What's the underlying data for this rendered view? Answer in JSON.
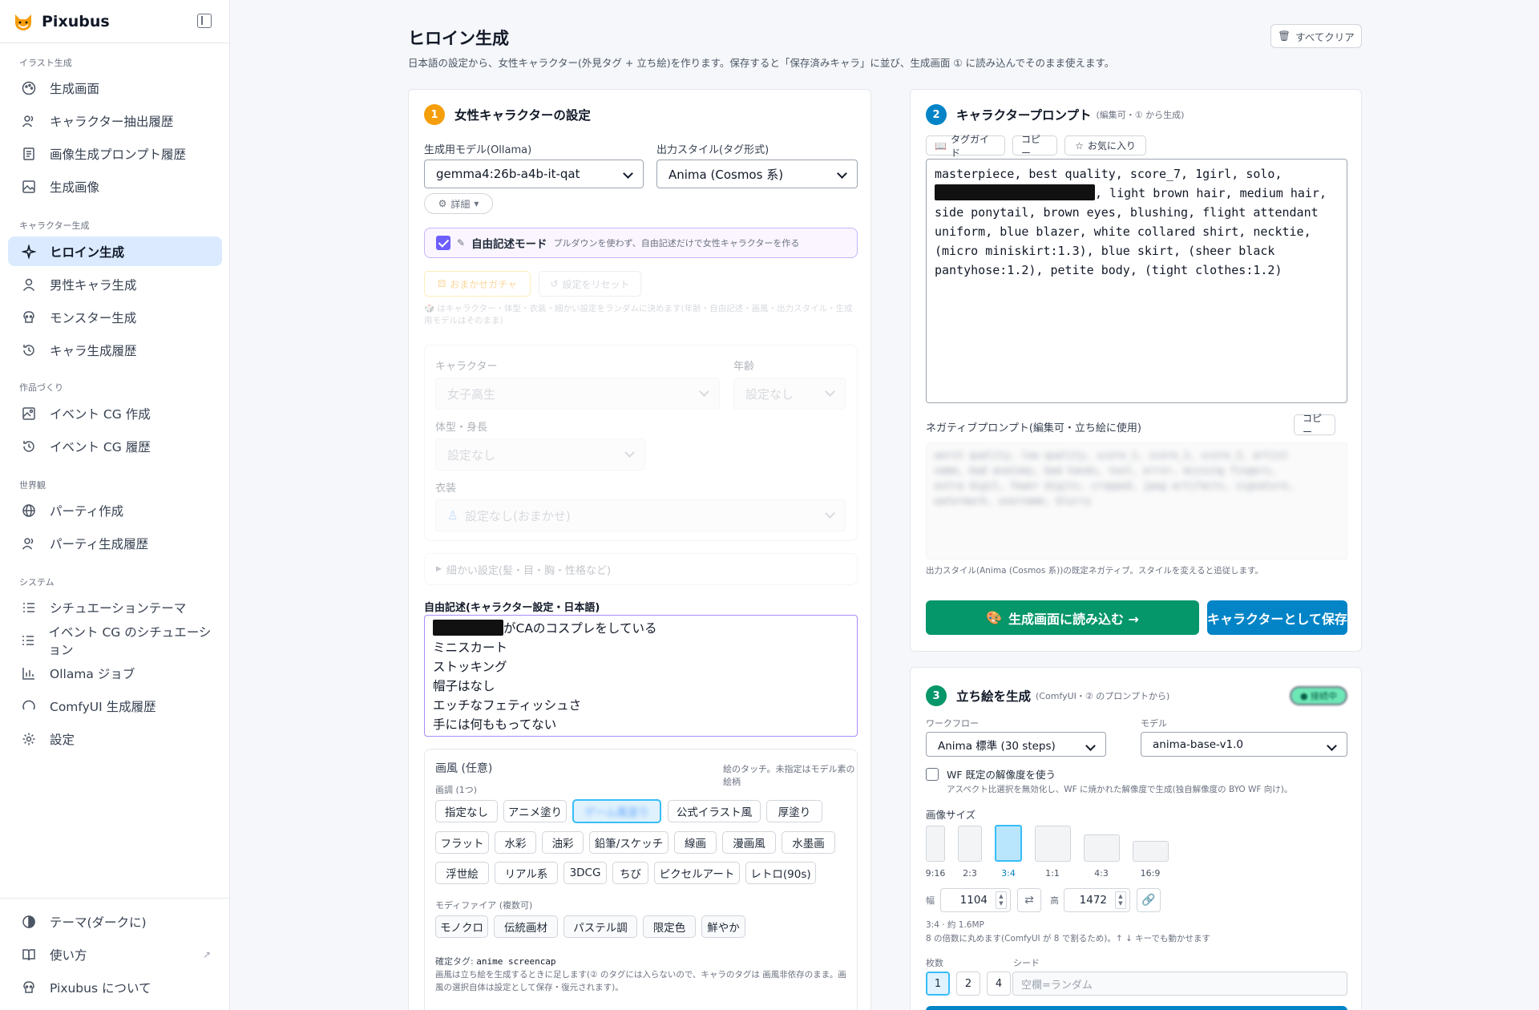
{
  "app": {
    "name": "Pixubus"
  },
  "sidebar": {
    "sections": [
      {
        "title": "イラスト生成",
        "items": [
          {
            "label": "生成画面",
            "icon": "palette-icon"
          },
          {
            "label": "キャラクター抽出履歴",
            "icon": "users-icon"
          },
          {
            "label": "画像生成プロンプト履歴",
            "icon": "scroll-icon"
          },
          {
            "label": "生成画像",
            "icon": "images-icon"
          }
        ]
      },
      {
        "title": "キャラクター生成",
        "items": [
          {
            "label": "ヒロイン生成",
            "icon": "sparkles-icon"
          },
          {
            "label": "男性キャラ生成",
            "icon": "user-icon"
          },
          {
            "label": "モンスター生成",
            "icon": "skull-icon"
          },
          {
            "label": "キャラ生成履歴",
            "icon": "history-icon"
          }
        ]
      },
      {
        "title": "作品づくり",
        "items": [
          {
            "label": "イベント CG 作成",
            "icon": "image-plus-icon"
          },
          {
            "label": "イベント CG 履歴",
            "icon": "history-icon"
          }
        ]
      },
      {
        "title": "世界観",
        "items": [
          {
            "label": "パーティ作成",
            "icon": "globe-icon"
          },
          {
            "label": "パーティ生成履歴",
            "icon": "users-icon"
          }
        ]
      },
      {
        "title": "システム",
        "items": [
          {
            "label": "シチュエーションテーマ",
            "icon": "list-icon"
          },
          {
            "label": "イベント CG のシチュエーション",
            "icon": "list-icon"
          },
          {
            "label": "Ollama ジョブ",
            "icon": "bar-chart-icon"
          },
          {
            "label": "ComfyUI 生成履歴",
            "icon": "loader-icon"
          },
          {
            "label": "設定",
            "icon": "gear-icon"
          }
        ]
      }
    ],
    "active": "ヒロイン生成",
    "bottom": [
      {
        "label": "テーマ(ダークに)",
        "icon": "theme-icon"
      },
      {
        "label": "使い方",
        "icon": "book-icon"
      },
      {
        "label": "Pixubus について",
        "icon": "info-icon"
      }
    ]
  },
  "page": {
    "title": "ヒロイン生成",
    "description": "日本語の設定から、女性キャラクター(外見タグ + 立ち絵)を作ります。保存すると「保存済みキャラ」に並び、生成画面 ① に読み込んでそのまま使えます。",
    "clear_all": "すべてクリア"
  },
  "card1": {
    "step": "1",
    "title": "女性キャラクターの設定",
    "model_label": "生成用モデル(Ollama)",
    "model_value": "gemma4:26b-a4b-it-qat",
    "style_label": "出力スタイル(タグ形式)",
    "style_value": "Anima (Cosmos 系)",
    "details_btn": "詳細",
    "freemode_label": "自由記述モード",
    "freemode_desc": "プルダウンを使わず、自由記述だけで女性キャラクターを作る",
    "gacha_btn": "おまかせガチャ",
    "reset_btn": "設定をリセット",
    "gacha_note": "はキャラクター・体型・衣装・細かい設定をランダムに決めます(年齢・自由記述・画風・出力スタイル・生成用モデルはそのまま)",
    "character_label": "キャラクター",
    "character_value": "女子高生",
    "age_label": "年齢",
    "age_placeholder": "設定なし",
    "body_label": "体型・身長",
    "body_value": "設定なし",
    "outfit_label": "衣装",
    "outfit_value": "設定なし(おまかせ)",
    "fine_settings": "細かい設定(髪・目・胸・性格など)",
    "free_label": "自由記述(キャラクター設定・日本語)",
    "free_lines": [
      "がCAのコスプレをしている",
      "ミニスカート",
      "ストッキング",
      "帽子はなし",
      "エッチなフェティッシュさ",
      "手には何ももってない"
    ],
    "art_title": "画風 (任意)",
    "art_hint": "絵のタッチ。未指定はモデル素の絵柄",
    "tone_label": "画調 (1つ)",
    "tones": [
      "指定なし",
      "アニメ塗り",
      "ゲーム風塗り",
      "公式イラスト風",
      "厚塗り",
      "フラット",
      "水彩",
      "油彩",
      "鉛筆/スケッチ",
      "線画",
      "漫画風",
      "水墨画",
      "浮世絵",
      "リアル系",
      "3DCG",
      "ちび",
      "ピクセルアート",
      "レトロ(90s)"
    ],
    "mod_label": "モディファイア (複数可)",
    "modifiers": [
      "モノクロ",
      "伝統画材",
      "パステル調",
      "限定色",
      "鮮やか"
    ],
    "confirmed_label": "確定タグ:",
    "confirmed_tags": "anime screencap",
    "art_note": "画風は立ち絵を生成するときに足します(② のタグには入らないので、キャラのタグは 画風非依存のまま。画風の選択自体は設定として保存・復元されます)。"
  },
  "card2": {
    "step": "2",
    "title": "キャラクタープロンプト",
    "subtitle": "(編集可・① から生成)",
    "tag_guide": "タグガイド",
    "copy": "コピー",
    "favorites": "お気に入り",
    "prompt_line1": "masterpiece, best quality, score_7, 1girl, solo,",
    "prompt_line2": ", light brown hair, medium hair,",
    "prompt_rest": "side ponytail, brown eyes, blushing, flight attendant\nuniform, blue blazer, white collared shirt, necktie,\n(micro miniskirt:1.3), blue skirt, (sheer black\npantyhose:1.2), petite body, (tight clothes:1.2)",
    "neg_label": "ネガティブプロンプト(編集可・立ち絵に使用)",
    "neg_copy": "コピー",
    "neg_text": "worst quality, low quality, score_1, score_2, score_3, artist\nname, bad anatomy, bad hands, text, error, missing fingers,\nextra digit, fewer digits, cropped, jpeg artifacts, signature,\nwatermark, username, blurry",
    "neg_note": "出力スタイル(Anima (Cosmos 系))の既定ネガティブ。スタイルを変えると追従します。",
    "load_btn": "生成画面に読み込む →",
    "save_btn": "キャラクターとして保存"
  },
  "card3": {
    "step": "3",
    "title": "立ち絵を生成",
    "subtitle": "(ComfyUI・② のプロンプトから)",
    "status": "● 接続中",
    "workflow_label": "ワークフロー",
    "workflow_value": "Anima 標準 (30 steps)",
    "model_label": "モデル",
    "model_value": "anima-base-v1.0",
    "wf_res_label": "WF 既定の解像度を使う",
    "wf_res_desc": "アスペクト比選択を無効化し、WF に焼かれた解像度で生成(独自解像度の BYO WF 向け)。",
    "size_label": "画像サイズ",
    "ratios": [
      "9:16",
      "2:3",
      "3:4",
      "1:1",
      "4:3",
      "16:9"
    ],
    "ratio_selected": "3:4",
    "width_label": "幅",
    "width": "1104",
    "height_label": "高",
    "height": "1472",
    "size_info": "3:4 · 約 1.6MP",
    "size_note": "8 の倍数に丸めます(ComfyUI が 8 で割るため)。↑ ↓ キーでも動かせます",
    "count_label": "枚数",
    "counts": [
      "1",
      "2",
      "4"
    ],
    "count_selected": "1",
    "seed_label": "シード",
    "seed_placeholder": "空欄=ランダム"
  },
  "colors": {
    "accent": "#0284c7",
    "green": "#059669",
    "orange": "#f59e0b",
    "purple": "#6d5dfc",
    "active_bg": "#dbeafe"
  }
}
